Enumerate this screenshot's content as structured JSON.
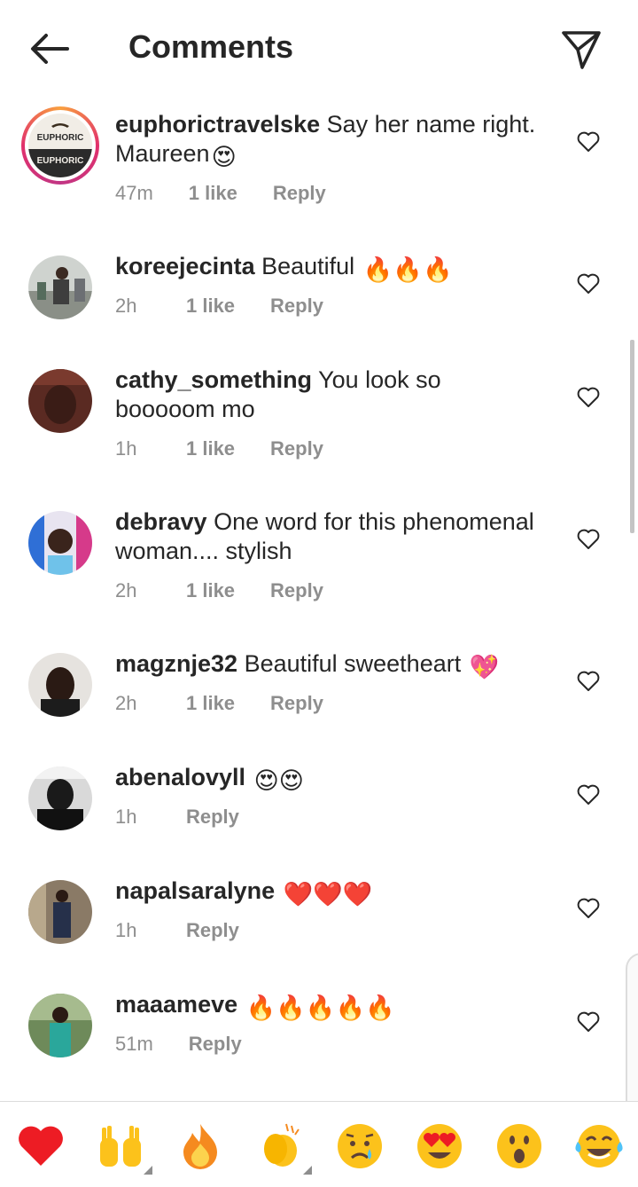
{
  "header": {
    "title": "Comments"
  },
  "comments": [
    {
      "username": "euphorictravelske",
      "text": "Say her name right. Maureen",
      "emoji": "😍",
      "time": "47m",
      "likes": "1 like",
      "reply": "Reply",
      "logo_text": "EUPHORIC"
    },
    {
      "username": "koreejecinta",
      "text": "Beautiful",
      "emoji": "🔥🔥🔥",
      "time": "2h",
      "likes": "1 like",
      "reply": "Reply"
    },
    {
      "username": "cathy_something",
      "text": "You look so booooom mo",
      "emoji": "",
      "time": "1h",
      "likes": "1 like",
      "reply": "Reply"
    },
    {
      "username": "debravy",
      "text": "One word for this phenomenal woman.... stylish",
      "emoji": "",
      "time": "2h",
      "likes": "1 like",
      "reply": "Reply"
    },
    {
      "username": "magznje32",
      "text": "Beautiful sweetheart",
      "emoji": "💖",
      "time": "2h",
      "likes": "1 like",
      "reply": "Reply"
    },
    {
      "username": "abenalovyll",
      "text": "",
      "emoji": "😍😍",
      "time": "1h",
      "likes": "",
      "reply": "Reply"
    },
    {
      "username": "napalsaralyne",
      "text": "",
      "emoji": "❤️❤️❤️",
      "time": "1h",
      "likes": "",
      "reply": "Reply"
    },
    {
      "username": "maaameve",
      "text": "",
      "emoji": "🔥🔥🔥🔥🔥",
      "time": "51m",
      "likes": "",
      "reply": "Reply"
    }
  ],
  "quick_reactions": [
    "❤️",
    "🙌",
    "🔥",
    "👏",
    "😢",
    "😍",
    "😮",
    "😂"
  ],
  "colors": {
    "text": "#262626",
    "meta": "#8e8e8e",
    "divider": "#dbdbdb",
    "heart_red": "#ed1c24"
  },
  "icons": {
    "back": "arrow-left-icon",
    "share": "send-icon",
    "like": "heart-outline-icon"
  }
}
